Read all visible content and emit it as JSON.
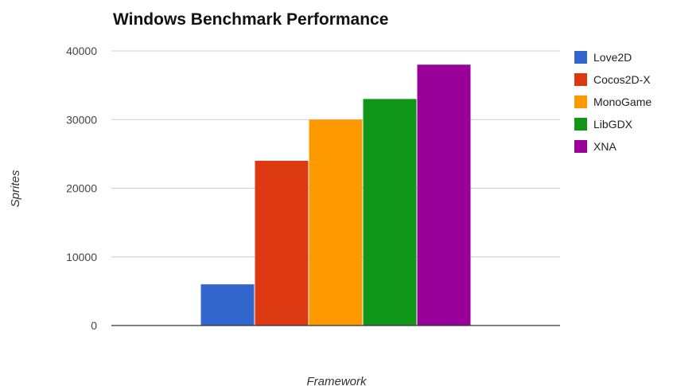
{
  "chart_data": {
    "type": "bar",
    "title": "Windows Benchmark Performance",
    "xlabel": "Framework",
    "ylabel": "Sprites",
    "categories": [
      ""
    ],
    "series": [
      {
        "name": "Love2D",
        "values": [
          6000
        ],
        "color": "#3366cc"
      },
      {
        "name": "Cocos2D-X",
        "values": [
          24000
        ],
        "color": "#dc3912"
      },
      {
        "name": "MonoGame",
        "values": [
          30000
        ],
        "color": "#ff9900"
      },
      {
        "name": "LibGDX",
        "values": [
          33000
        ],
        "color": "#109618"
      },
      {
        "name": "XNA",
        "values": [
          38000
        ],
        "color": "#990099"
      }
    ],
    "ylim": [
      0,
      40000
    ],
    "yticks": [
      "40000",
      "30000",
      "20000",
      "10000",
      "0"
    ],
    "grid": true,
    "legend_position": "right"
  }
}
